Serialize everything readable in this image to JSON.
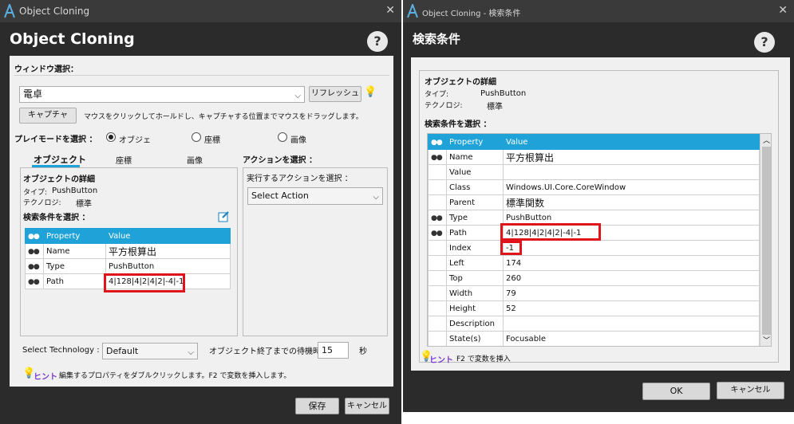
{
  "left": {
    "title": "Object Cloning",
    "heading": "Object Cloning",
    "help": "?",
    "window_select_label": "ウィンドウ選択：",
    "window_value": "電卓",
    "refresh": "リフレッシュ",
    "capture": "キャプチャ",
    "capture_hint": "マウスをクリックしてホールドし、キャプチャする位置までマウスをドラッグします。",
    "playmode_label": "プレイモードを選択 ：",
    "playmodes": [
      "オブジェ",
      "座標",
      "画像"
    ],
    "tabs": [
      "オブジェクト",
      "座標",
      "画像"
    ],
    "details_title": "オブジェクトの詳細",
    "type_label": "タイプ:",
    "type_value": "PushButton",
    "tech_label": "テクノロジ:",
    "tech_value": "標準",
    "search_label": "検索条件を選択 ：",
    "grid_headers": [
      "Property",
      "Value"
    ],
    "grid_rows": [
      {
        "prop": "Name",
        "value": "平方根算出"
      },
      {
        "prop": "Type",
        "value": "PushButton"
      },
      {
        "prop": "Path",
        "value": "4|128|4|2|4|2|-4|-1"
      }
    ],
    "action_label": "アクションを選択 ：",
    "action_group_label": "実行するアクションを選択 ：",
    "action_value": "Select Action",
    "tech_select_label": "Select Technology :",
    "tech_select_value": "Default",
    "wait_label": "オブジェクト終了までの待機時間",
    "wait_value": "15",
    "wait_unit": "秒",
    "hint_tag": "ヒント",
    "hint_text": "編集するプロパティをダブルクリックします。F2 で変数を挿入します。",
    "save": "保存",
    "cancel": "キャンセル"
  },
  "right": {
    "title": "Object Cloning - 検索条件",
    "heading": "検索条件",
    "help": "?",
    "details_title": "オブジェクトの詳細",
    "type_label": "タイプ:",
    "type_value": "PushButton",
    "tech_label": "テクノロジ:",
    "tech_value": "標準",
    "search_label": "検索条件を選択 ：",
    "grid_headers": [
      "Property",
      "Value"
    ],
    "grid_rows": [
      {
        "prop": "Name",
        "value": "平方根算出",
        "checked": true
      },
      {
        "prop": "Value",
        "value": "",
        "checked": false
      },
      {
        "prop": "Class",
        "value": "Windows.UI.Core.CoreWindow",
        "checked": false
      },
      {
        "prop": "Parent",
        "value": "標準関数",
        "checked": false
      },
      {
        "prop": "Type",
        "value": "PushButton",
        "checked": true
      },
      {
        "prop": "Path",
        "value": "4|128|4|2|4|2|-4|-1",
        "checked": true
      },
      {
        "prop": "Index",
        "value": "-1",
        "checked": false
      },
      {
        "prop": "Left",
        "value": "174",
        "checked": false
      },
      {
        "prop": "Top",
        "value": "260",
        "checked": false
      },
      {
        "prop": "Width",
        "value": "79",
        "checked": false
      },
      {
        "prop": "Height",
        "value": "52",
        "checked": false
      },
      {
        "prop": "Description",
        "value": "",
        "checked": false
      },
      {
        "prop": "State(s)",
        "value": "Focusable",
        "checked": false
      }
    ],
    "hint_tag": "ヒント",
    "hint_text": "F2 で変数を挿入",
    "ok": "OK",
    "cancel": "キャンセル"
  }
}
